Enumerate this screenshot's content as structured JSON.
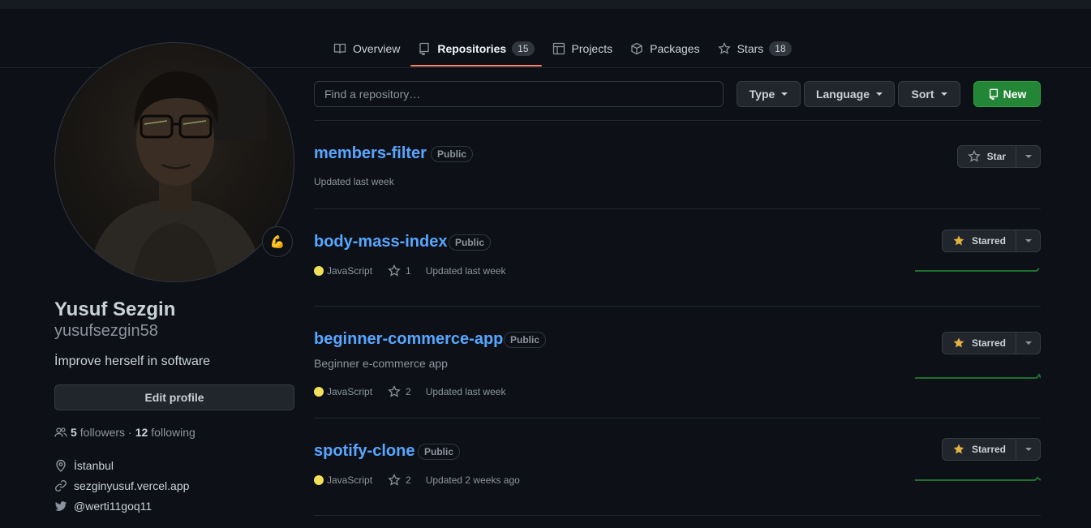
{
  "tabs": [
    {
      "label": "Overview",
      "icon": "book-icon"
    },
    {
      "label": "Repositories",
      "icon": "repo-icon",
      "count": "15"
    },
    {
      "label": "Projects",
      "icon": "table-icon"
    },
    {
      "label": "Packages",
      "icon": "package-icon"
    },
    {
      "label": "Stars",
      "icon": "star-icon",
      "count": "18"
    }
  ],
  "profile": {
    "fullname": "Yusuf Sezgin",
    "username": "yusufsezgin58",
    "bio": "İmprove herself in software",
    "edit_label": "Edit profile",
    "status_emoji": "💪",
    "followers_count": "5",
    "followers_label": "followers",
    "dot": "·",
    "following_count": "12",
    "following_label": "following",
    "location": "İstanbul",
    "website": "sezginyusuf.vercel.app",
    "twitter": "@werti11goq11"
  },
  "toolbar": {
    "search_placeholder": "Find a repository…",
    "type_label": "Type",
    "language_label": "Language",
    "sort_label": "Sort",
    "new_label": "New"
  },
  "repos": [
    {
      "name": "members-filter",
      "visibility": "Public",
      "description": "",
      "language": "",
      "stars": "",
      "updated": "Updated last week",
      "star_label": "Star",
      "starred": false
    },
    {
      "name": "body-mass-index",
      "visibility": "Public",
      "description": "",
      "language": "JavaScript",
      "stars": "1",
      "updated": "Updated last week",
      "star_label": "Starred",
      "starred": true
    },
    {
      "name": "beginner-commerce-app",
      "visibility": "Public",
      "description": "Beginner e-commerce app",
      "language": "JavaScript",
      "stars": "2",
      "updated": "Updated last week",
      "star_label": "Starred",
      "starred": true
    },
    {
      "name": "spotify-clone",
      "visibility": "Public",
      "description": "",
      "language": "JavaScript",
      "stars": "2",
      "updated": "Updated 2 weeks ago",
      "star_label": "Starred",
      "starred": true
    }
  ],
  "colors": {
    "javascript": "#f1e05a",
    "link": "#58a6ff",
    "accent_underline": "#f78166",
    "new_button": "#238636",
    "starred_icon": "#e3b341",
    "sparkline": "#1f6f2e"
  }
}
